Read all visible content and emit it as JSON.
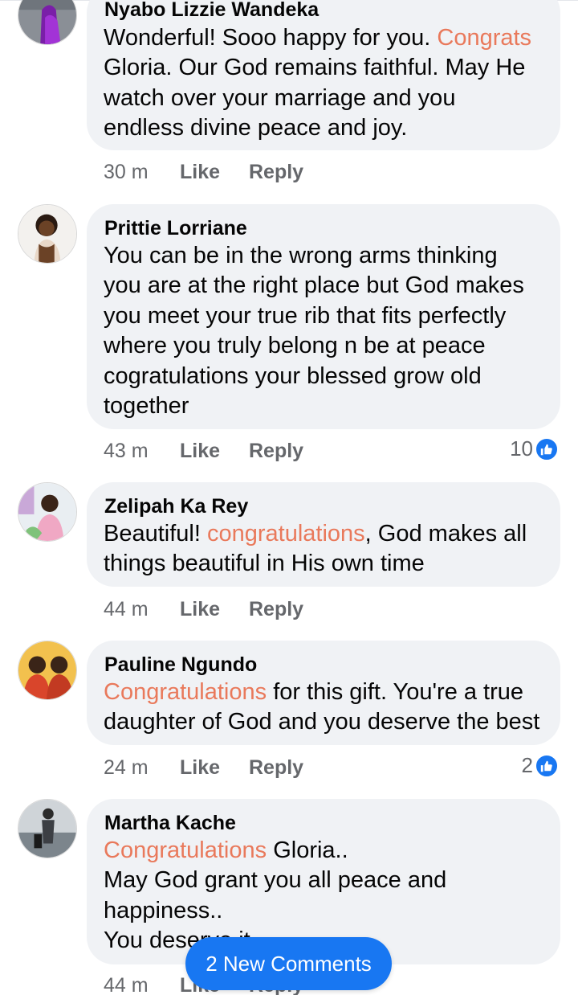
{
  "comments": [
    {
      "author": "Nyabo Lizzie Wandeka",
      "lines": [
        [
          {
            "t": "Wonderful! Sooo happy for you. "
          },
          {
            "t": "Congrats",
            "hl": true
          }
        ],
        [
          {
            "t": "Gloria. Our God remains faithful. May He"
          }
        ],
        [
          {
            "t": "watch over your marriage and you"
          }
        ],
        [
          {
            "t": "endless divine peace and joy."
          }
        ]
      ],
      "time": "30 m",
      "like_label": "Like",
      "reply_label": "Reply",
      "reactions": null,
      "avatar_icon": "avatar-purple-portrait"
    },
    {
      "author": "Prittie Lorriane",
      "lines": [
        [
          {
            "t": "You can be in the wrong arms thinking"
          }
        ],
        [
          {
            "t": "you are at the right place but God makes"
          }
        ],
        [
          {
            "t": "you meet your true rib that fits perfectly"
          }
        ],
        [
          {
            "t": "where you truly belong n be at peace"
          }
        ],
        [
          {
            "t": "cogratulations your blessed grow old"
          }
        ],
        [
          {
            "t": "together"
          }
        ]
      ],
      "time": "43 m",
      "like_label": "Like",
      "reply_label": "Reply",
      "reactions": "10",
      "avatar_icon": "avatar-portrait"
    },
    {
      "author": "Zelipah Ka Rey",
      "lines": [
        [
          {
            "t": "Beautiful! "
          },
          {
            "t": "congratulations",
            "hl": true
          },
          {
            "t": ", God makes all"
          }
        ],
        [
          {
            "t": "things beautiful in His own time"
          }
        ]
      ],
      "time": "44 m",
      "like_label": "Like",
      "reply_label": "Reply",
      "reactions": null,
      "avatar_icon": "avatar-portrait"
    },
    {
      "author": "Pauline Ngundo",
      "lines": [
        [
          {
            "t": "Congratulations",
            "hl": true
          },
          {
            "t": " for this gift. You're a true"
          }
        ],
        [
          {
            "t": "daughter of God and you deserve the best"
          }
        ]
      ],
      "time": "24 m",
      "like_label": "Like",
      "reply_label": "Reply",
      "reactions": "2",
      "avatar_icon": "avatar-group-photo"
    },
    {
      "author": "Martha Kache",
      "lines": [
        [
          {
            "t": "Congratulations",
            "hl": true
          },
          {
            "t": " Gloria.."
          }
        ],
        [
          {
            "t": "May God grant you all peace and"
          }
        ],
        [
          {
            "t": "happiness.."
          }
        ],
        [
          {
            "t": "You deserve it"
          }
        ]
      ],
      "time": "44 m",
      "like_label": "Like",
      "reply_label": "Reply",
      "reactions": null,
      "avatar_icon": "avatar-portrait"
    }
  ],
  "new_comments_button": "2 New Comments",
  "colors": {
    "highlight": "#e9795b",
    "brand_blue": "#1877f2",
    "bubble": "#f0f2f5",
    "meta": "#65676b"
  }
}
